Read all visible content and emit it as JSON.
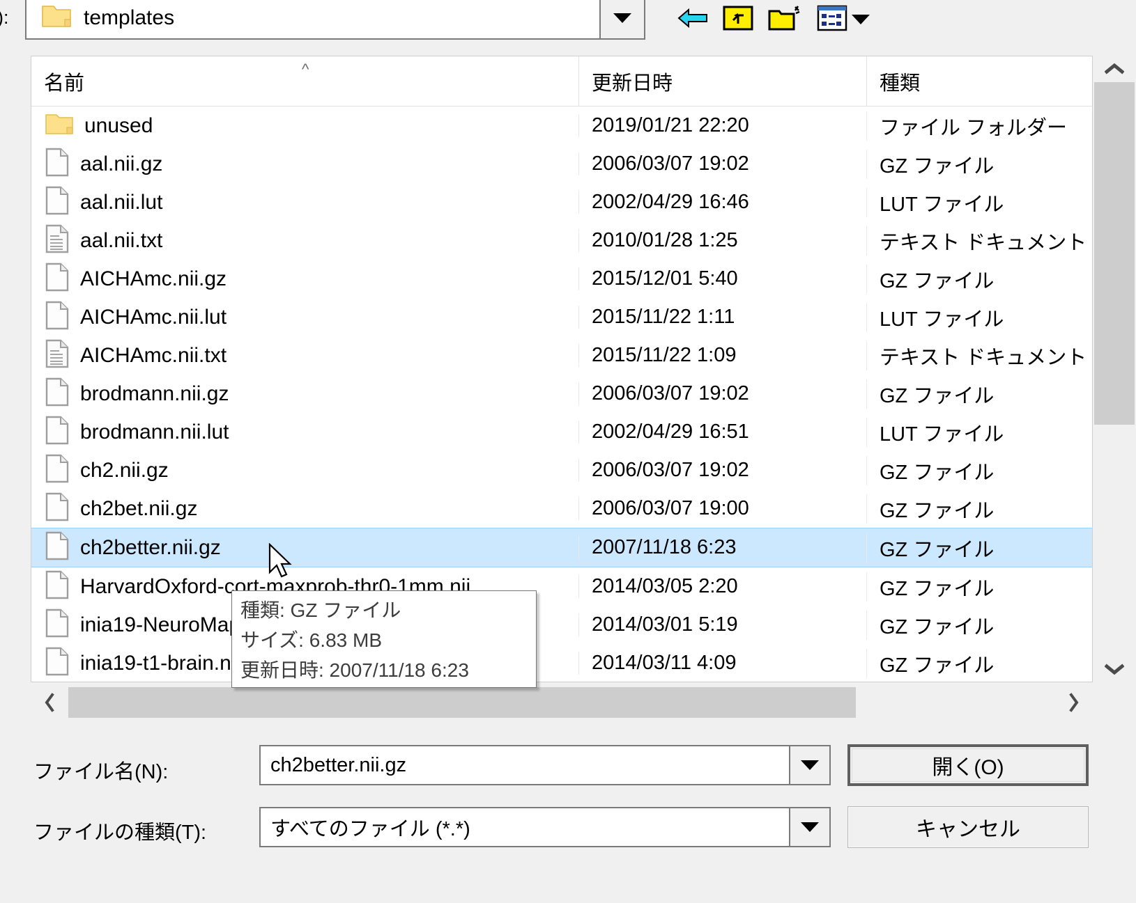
{
  "dialog": {
    "look_in_label": "):",
    "look_in_value": "templates",
    "toolbar": {
      "back": "back-arrow",
      "up": "up-one-level",
      "new_folder": "create-new-folder",
      "views": "views-menu"
    }
  },
  "columns": {
    "name": "名前",
    "date": "更新日時",
    "type": "種類",
    "sort_indicator": "ascending"
  },
  "files": [
    {
      "name": "unused",
      "date": "2019/01/21 22:20",
      "type": "ファイル フォルダー",
      "icon": "folder",
      "selected": false
    },
    {
      "name": "aal.nii.gz",
      "date": "2006/03/07 19:02",
      "type": "GZ ファイル",
      "icon": "file",
      "selected": false
    },
    {
      "name": "aal.nii.lut",
      "date": "2002/04/29 16:46",
      "type": "LUT ファイル",
      "icon": "file",
      "selected": false
    },
    {
      "name": "aal.nii.txt",
      "date": "2010/01/28 1:25",
      "type": "テキスト ドキュメント",
      "icon": "textfile",
      "selected": false
    },
    {
      "name": "AICHAmc.nii.gz",
      "date": "2015/12/01 5:40",
      "type": "GZ ファイル",
      "icon": "file",
      "selected": false
    },
    {
      "name": "AICHAmc.nii.lut",
      "date": "2015/11/22 1:11",
      "type": "LUT ファイル",
      "icon": "file",
      "selected": false
    },
    {
      "name": "AICHAmc.nii.txt",
      "date": "2015/11/22 1:09",
      "type": "テキスト ドキュメント",
      "icon": "textfile",
      "selected": false
    },
    {
      "name": "brodmann.nii.gz",
      "date": "2006/03/07 19:02",
      "type": "GZ ファイル",
      "icon": "file",
      "selected": false
    },
    {
      "name": "brodmann.nii.lut",
      "date": "2002/04/29 16:51",
      "type": "LUT ファイル",
      "icon": "file",
      "selected": false
    },
    {
      "name": "ch2.nii.gz",
      "date": "2006/03/07 19:02",
      "type": "GZ ファイル",
      "icon": "file",
      "selected": false
    },
    {
      "name": "ch2bet.nii.gz",
      "date": "2006/03/07 19:00",
      "type": "GZ ファイル",
      "icon": "file",
      "selected": false
    },
    {
      "name": "ch2better.nii.gz",
      "date": "2007/11/18 6:23",
      "type": "GZ ファイル",
      "icon": "file",
      "selected": true
    },
    {
      "name": "HarvardOxford-cort-maxprob-thr0-1mm.nii....",
      "date": "2014/03/05 2:20",
      "type": "GZ ファイル",
      "icon": "file",
      "selected": false
    },
    {
      "name": "inia19-NeuroMaps.nii.gz",
      "date": "2014/03/01 5:19",
      "type": "GZ ファイル",
      "icon": "file",
      "selected": false
    },
    {
      "name": "inia19-t1-brain.nii.gz",
      "date": "2014/03/11 4:09",
      "type": "GZ ファイル",
      "icon": "file",
      "selected": false
    }
  ],
  "tooltip": {
    "line1": "種類: GZ ファイル",
    "line2": "サイズ: 6.83 MB",
    "line3": "更新日時: 2007/11/18 6:23"
  },
  "form": {
    "filename_label": "ファイル名(N):",
    "filename_value": "ch2better.nii.gz",
    "filetype_label": "ファイルの種類(T):",
    "filetype_value": "すべてのファイル (*.*)"
  },
  "buttons": {
    "open": "開く(O)",
    "cancel": "キャンセル"
  },
  "scrollbars": {
    "v_up": "▲",
    "v_down": "▼",
    "h_left": "‹",
    "h_right": "›"
  },
  "colors": {
    "selection": "#cce8ff",
    "folder": "#fde08a",
    "dialog_bg": "#f0f0f0"
  }
}
